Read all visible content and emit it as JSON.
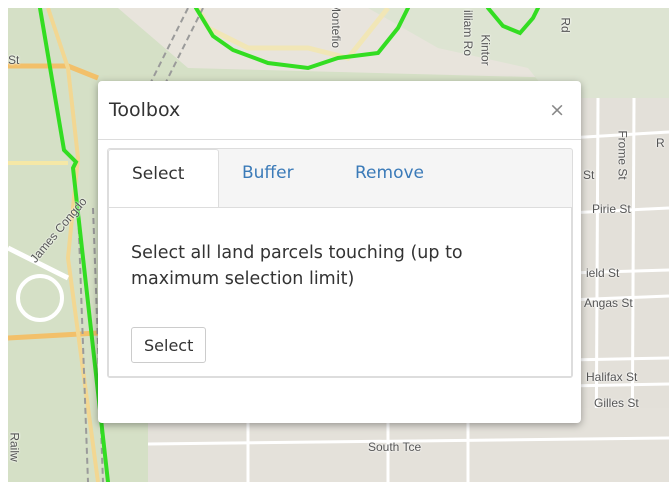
{
  "map": {
    "streets": [
      {
        "name": "st-left",
        "label": "St"
      },
      {
        "name": "montefiore",
        "label": "Montefio"
      },
      {
        "name": "william-rd",
        "label": "illiam Ro"
      },
      {
        "name": "kintore",
        "label": "Kintor"
      },
      {
        "name": "rd-top",
        "label": "Rd"
      },
      {
        "name": "frome-st",
        "label": "Frome St"
      },
      {
        "name": "st-right",
        "label": "St"
      },
      {
        "name": "pirie-st",
        "label": "Pirie St"
      },
      {
        "name": "james-congdon",
        "label": "James Congdo"
      },
      {
        "name": "field-st",
        "label": "ield St"
      },
      {
        "name": "angas-st",
        "label": "Angas St"
      },
      {
        "name": "halifax-st",
        "label": "Halifax St"
      },
      {
        "name": "gilles-st",
        "label": "Gilles St"
      },
      {
        "name": "south-tce",
        "label": "South Tce"
      },
      {
        "name": "railway",
        "label": "Railw"
      },
      {
        "name": "r-right",
        "label": "R"
      }
    ],
    "boundary_color": "#33dd22",
    "park_color": "#cfdcc0"
  },
  "toolbox": {
    "title": "Toolbox",
    "close_symbol": "×",
    "tabs": [
      {
        "label": "Select",
        "active": true
      },
      {
        "label": "Buffer",
        "active": false
      },
      {
        "label": "Remove",
        "active": false
      }
    ],
    "description": "Select all land parcels touching (up to maximum selection limit)",
    "button_label": "Select"
  },
  "colors": {
    "accent": "#3a7ab8",
    "text": "#333333"
  }
}
